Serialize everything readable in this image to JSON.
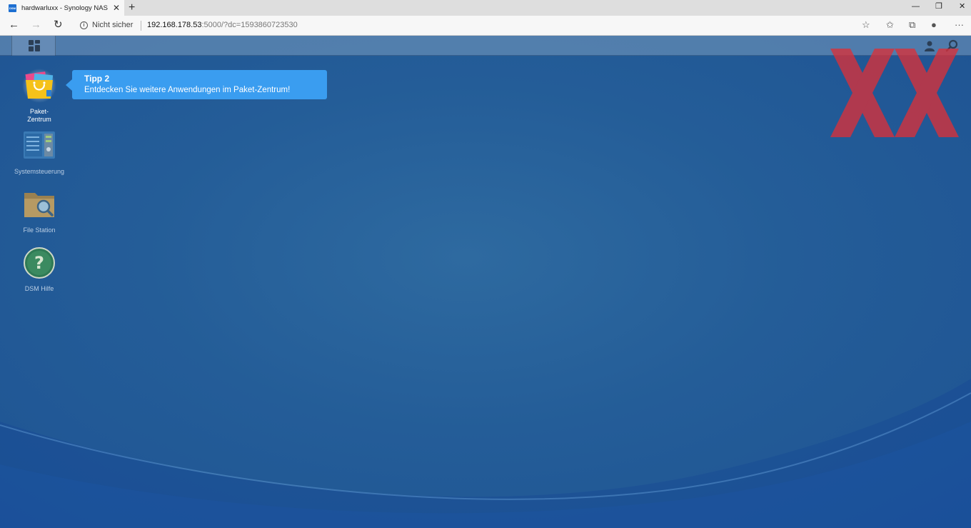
{
  "browser": {
    "tab_title": "hardwarluxx - Synology NAS",
    "favicon_text": "DSM",
    "tab_close": "✕",
    "new_tab": "+",
    "security_label": "Nicht sicher",
    "url_host": "192.168.178.53",
    "url_rest": ":5000/?dc=1593860723530",
    "icons": [
      "back-icon",
      "forward-icon",
      "reload-icon",
      "info-icon",
      "star-icon",
      "favorites-icon",
      "collections-icon",
      "profile-icon",
      "more-icon",
      "minimize-icon",
      "maximize-icon",
      "close-icon"
    ]
  },
  "desktop": {
    "icons": [
      {
        "label": "Paket-\nZentrum",
        "icon": "package-center-icon"
      },
      {
        "label": "Systemsteuerung",
        "icon": "control-panel-icon"
      },
      {
        "label": "File Station",
        "icon": "file-station-icon"
      },
      {
        "label": "DSM Hilfe",
        "icon": "dsm-help-icon"
      }
    ]
  },
  "tooltip": {
    "title": "Tipp 2",
    "text": "Entdecken Sie weitere Anwendungen im Paket-Zentrum!"
  },
  "colors": {
    "desktop_bg": "#245d98",
    "tooltip_bg": "#3a9df0",
    "watermark": "#d9313a"
  }
}
